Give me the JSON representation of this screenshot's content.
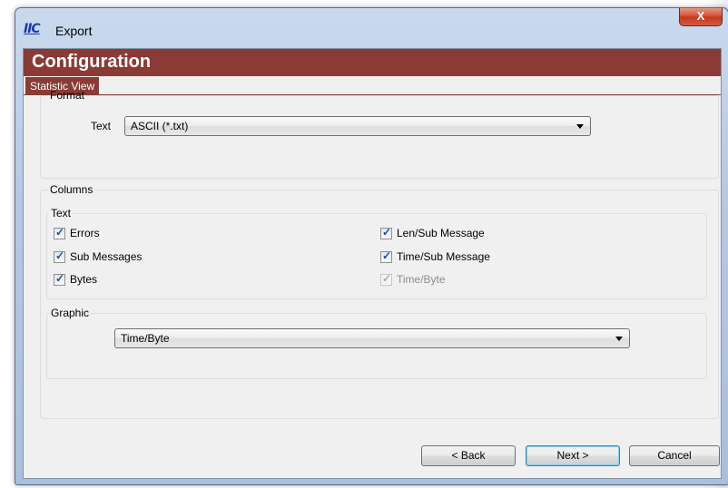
{
  "window": {
    "app_icon": "IIC",
    "title": "Export",
    "close_label": "X"
  },
  "header": {
    "title": "Configuration",
    "tab": "Statistic View"
  },
  "format": {
    "group_label": "Format",
    "text_label": "Text",
    "text_value": "ASCII (*.txt)"
  },
  "columns": {
    "group_label": "Columns",
    "text_group_label": "Text",
    "checkboxes": [
      {
        "label": "Errors",
        "checked": true,
        "enabled": true
      },
      {
        "label": "Sub Messages",
        "checked": true,
        "enabled": true
      },
      {
        "label": "Bytes",
        "checked": true,
        "enabled": true
      },
      {
        "label": "Len/Sub Message",
        "checked": true,
        "enabled": true
      },
      {
        "label": "Time/Sub Message",
        "checked": true,
        "enabled": true
      },
      {
        "label": "Time/Byte",
        "checked": true,
        "enabled": false
      }
    ],
    "graphic_group_label": "Graphic",
    "graphic_value": "Time/Byte"
  },
  "buttons": {
    "back": "< Back",
    "next": "Next >",
    "cancel": "Cancel"
  },
  "icons": {
    "checkmark": "checkmark-icon",
    "dropdown": "chevron-down-icon",
    "close": "close-icon"
  }
}
